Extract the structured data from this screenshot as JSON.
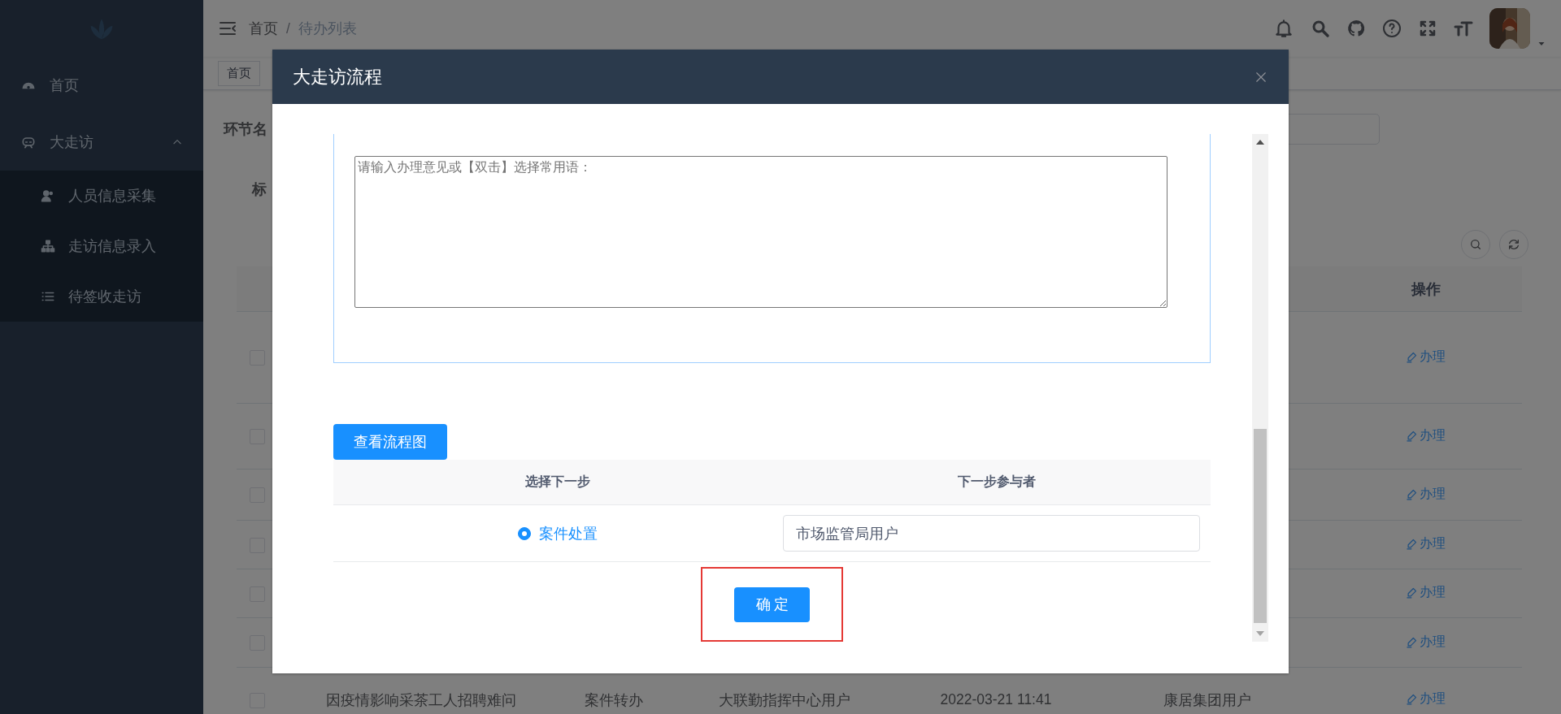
{
  "sidebar": {
    "items": [
      {
        "kind": "item",
        "label": "首页",
        "selected": false
      },
      {
        "kind": "group",
        "label": "大走访",
        "expanded": true,
        "children": [
          {
            "kind": "item",
            "label": "人员信息采集",
            "selected": false
          },
          {
            "kind": "item",
            "label": "走访信息录入",
            "selected": false
          },
          {
            "kind": "item",
            "label": "待签收走访",
            "selected": false
          }
        ]
      }
    ]
  },
  "navbar": {
    "breadcrumb": [
      "首页",
      "待办列表"
    ],
    "separator": "/"
  },
  "tags": [
    {
      "label": "首页",
      "selected": false
    }
  ],
  "filters": [
    {
      "label": "环节名"
    },
    {
      "label": "标"
    }
  ],
  "table": {
    "action_header": "操作",
    "rows": [
      {
        "checked": false,
        "action": "办理"
      },
      {
        "checked": false,
        "action": "办理"
      },
      {
        "checked": false,
        "action": "办理"
      },
      {
        "checked": false,
        "action": "办理"
      },
      {
        "checked": false,
        "action": "办理"
      },
      {
        "checked": false,
        "action": "办理"
      },
      {
        "checked": false,
        "cells": [
          "因疫情影响采茶工人招聘难问",
          "案件转办",
          "大联勤指挥中心用户",
          "2022-03-21 11:41",
          "康居集团用户"
        ],
        "action": "办理"
      }
    ]
  },
  "modal": {
    "title": "大走访流程",
    "opinion_placeholder": "请输入办理意见或【双击】选择常用语：",
    "flow_button": "查看流程图",
    "next_steps": {
      "columns": [
        "选择下一步",
        "下一步参与者"
      ],
      "rows": [
        {
          "step": "案件处置",
          "selected": true,
          "participant": "市场监管局用户"
        }
      ]
    },
    "confirm": "确定",
    "confirm_highlighted": true
  }
}
